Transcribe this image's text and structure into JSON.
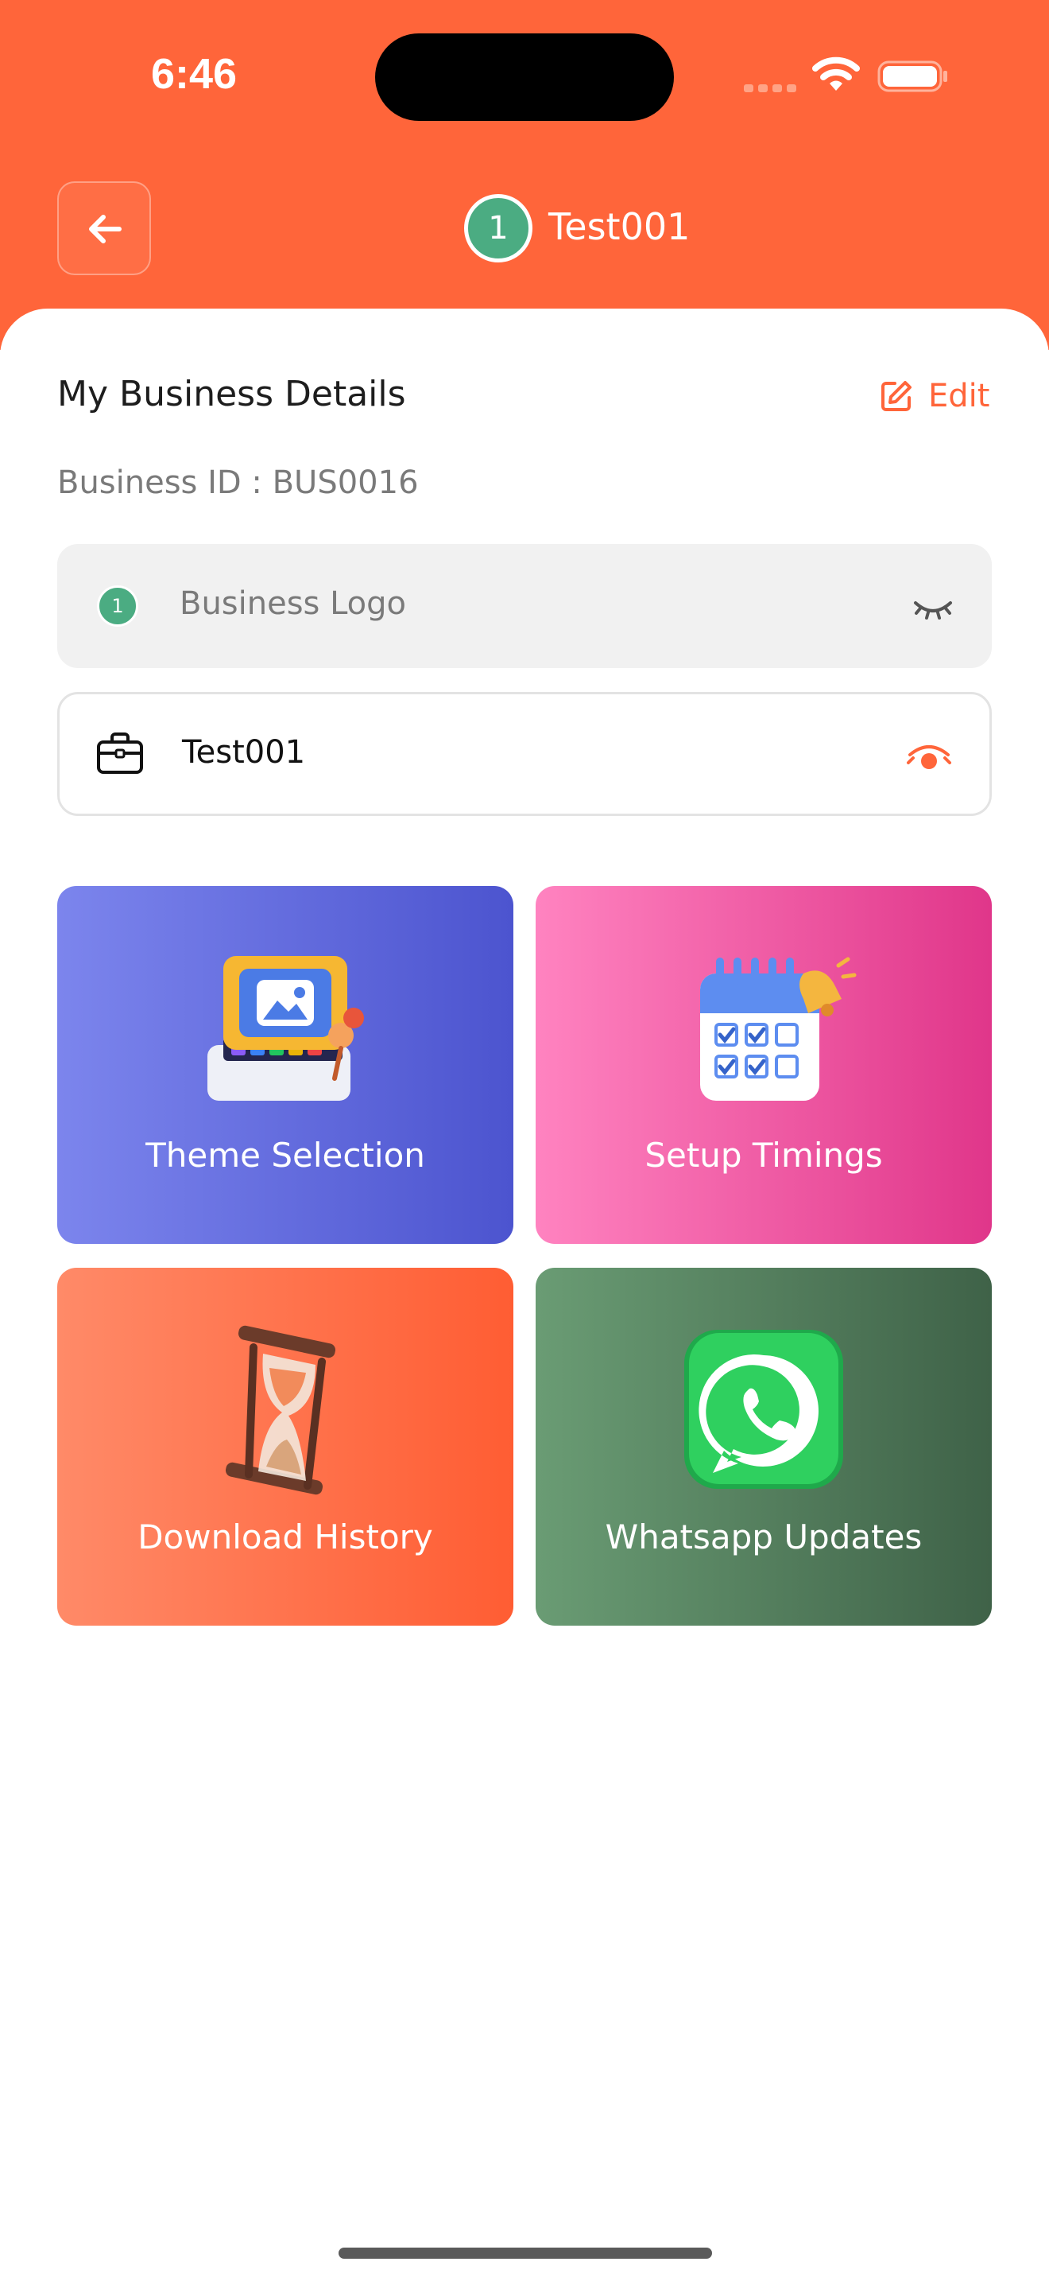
{
  "status_bar": {
    "time": "6:46"
  },
  "header": {
    "avatar_number": "1",
    "title": "Test001"
  },
  "details": {
    "section_title": "My Business Details",
    "edit_label": "Edit",
    "business_id": "Business ID : BUS0016"
  },
  "fields": {
    "logo": {
      "badge": "1",
      "label": "Business Logo"
    },
    "name": {
      "label": "Test001"
    }
  },
  "tiles": [
    {
      "label": "Theme Selection",
      "icon": "theme-image-icon"
    },
    {
      "label": "Setup Timings",
      "icon": "calendar-alarm-icon"
    },
    {
      "label": "Download History",
      "icon": "hourglass-icon"
    },
    {
      "label": "Whatsapp Updates",
      "icon": "whatsapp-icon"
    }
  ],
  "colors": {
    "accent": "#ff653a",
    "badge_green": "#4bac82",
    "theme_tile": [
      "#7c85ed",
      "#4c54cf"
    ],
    "timings_tile": [
      "#ff83c0",
      "#e0368a"
    ],
    "download_tile": [
      "#ff8a68",
      "#ff5d33"
    ],
    "whatsapp_tile": [
      "#6a9c74",
      "#3f6248"
    ]
  }
}
